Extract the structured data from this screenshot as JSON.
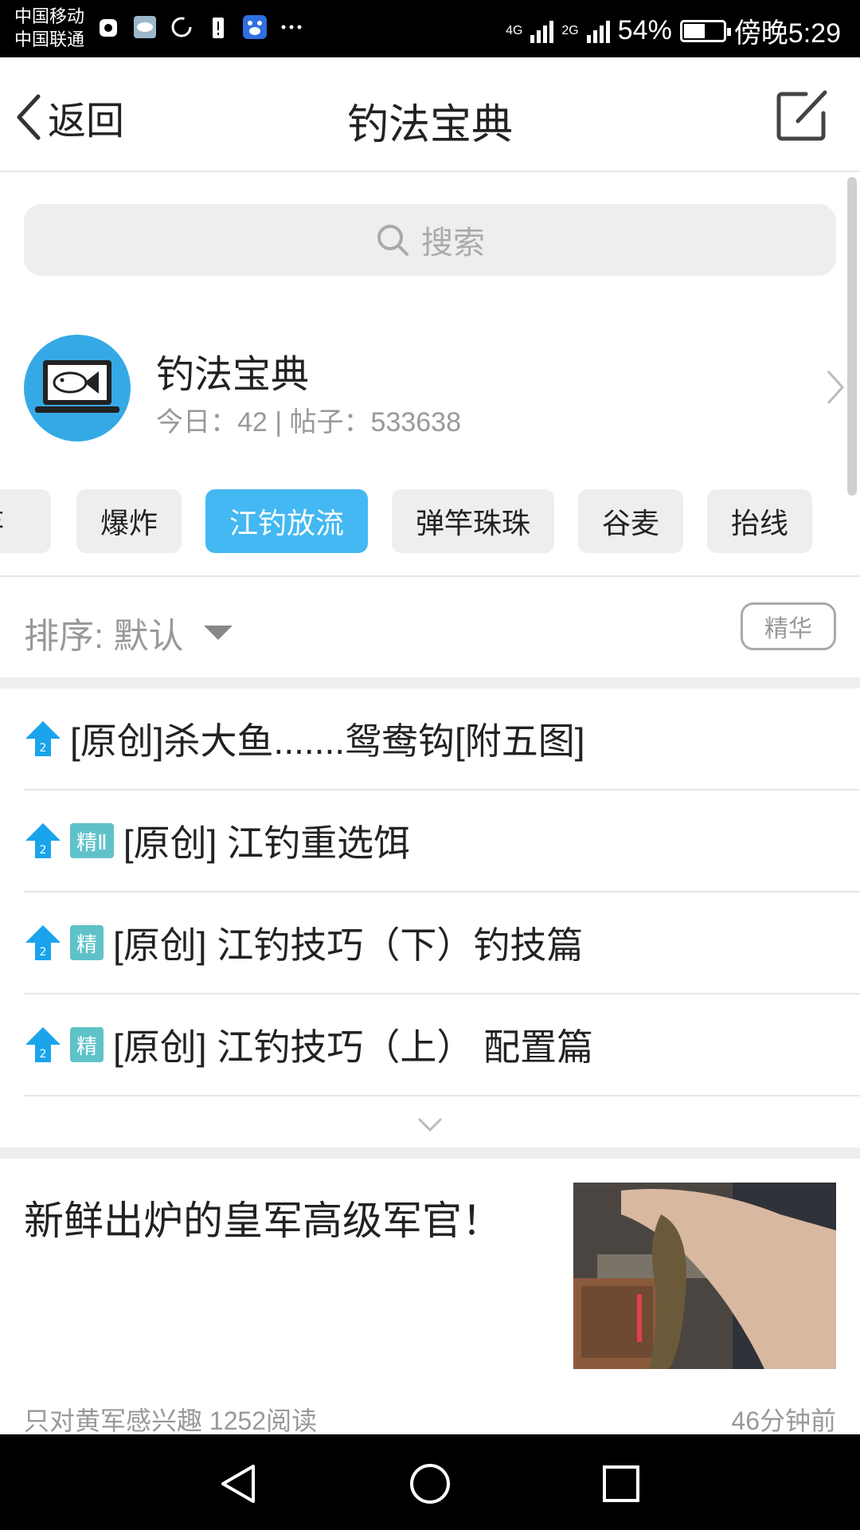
{
  "status_bar": {
    "carrier_1": "中国移动",
    "carrier_2": "中国联通",
    "net_1": "4G",
    "net_2": "2G",
    "battery": "54%",
    "battery_level": 0.54,
    "time": "傍晚5:29"
  },
  "header": {
    "back_label": "返回",
    "title": "钓法宝典"
  },
  "search": {
    "placeholder": "搜索"
  },
  "forum": {
    "name": "钓法宝典",
    "stats": "今日：42 | 帖子：533638"
  },
  "tags": [
    {
      "label": "竿",
      "active": false
    },
    {
      "label": "爆炸",
      "active": false
    },
    {
      "label": "江钓放流",
      "active": true
    },
    {
      "label": "弹竿珠珠",
      "active": false
    },
    {
      "label": "谷麦",
      "active": false
    },
    {
      "label": "抬线",
      "active": false
    }
  ],
  "sort": {
    "label": "排序: 默认",
    "filter_label": "精华"
  },
  "posts": [
    {
      "title": "[原创]杀大鱼.......鸳鸯钩[附五图]",
      "badge": ""
    },
    {
      "title": "[原创] 江钓重选饵",
      "badge": "精Ⅱ"
    },
    {
      "title": "[原创] 江钓技巧（下）钓技篇",
      "badge": "精"
    },
    {
      "title": "[原创] 江钓技巧（上） 配置篇",
      "badge": "精"
    }
  ],
  "card": {
    "title": "新鲜出炉的皇军高级军官！",
    "meta": "只对黄军感兴趣  1252阅读",
    "time": "46分钟前"
  },
  "icons": {
    "back": "chevron-left-icon",
    "edit": "edit-icon",
    "search": "search-icon",
    "top": "pin-top-icon"
  },
  "colors": {
    "accent": "#44b8f2",
    "top_icon": "#1aa4ec",
    "jing_badge": "#5fc2c9"
  }
}
